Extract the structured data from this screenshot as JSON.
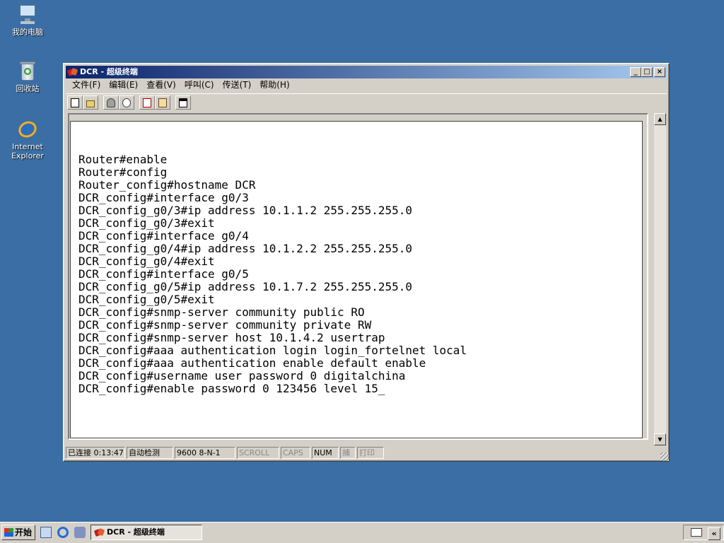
{
  "desktop": {
    "icons": [
      {
        "label": "我的电脑",
        "icon": "my-computer-icon"
      },
      {
        "label": "回收站",
        "icon": "recycle-bin-icon"
      },
      {
        "label": "Internet Explorer",
        "icon": "internet-explorer-icon"
      }
    ]
  },
  "window": {
    "title": "DCR - 超级终端",
    "controls": {
      "minimize": "_",
      "maximize": "□",
      "close": "×"
    },
    "menu": [
      {
        "label": "文件(F)"
      },
      {
        "label": "编辑(E)"
      },
      {
        "label": "查看(V)"
      },
      {
        "label": "呼叫(C)"
      },
      {
        "label": "传送(T)"
      },
      {
        "label": "帮助(H)"
      }
    ],
    "toolbar": [
      "new-file-icon",
      "open-folder-icon",
      "dial-phone-icon",
      "disconnect-icon",
      "send-file-icon",
      "receive-file-icon",
      "properties-icon"
    ],
    "terminal": {
      "lines": [
        "",
        "Router#enable",
        "Router#config",
        "Router_config#hostname DCR",
        "DCR_config#interface g0/3",
        "DCR_config_g0/3#ip address 10.1.1.2 255.255.255.0",
        "DCR_config_g0/3#exit",
        "DCR_config#interface g0/4",
        "DCR_config_g0/4#ip address 10.1.2.2 255.255.255.0",
        "DCR_config_g0/4#exit",
        "DCR_config#interface g0/5",
        "DCR_config_g0/5#ip address 10.1.7.2 255.255.255.0",
        "DCR_config_g0/5#exit",
        "DCR_config#snmp-server community public RO",
        "DCR_config#snmp-server community private RW",
        "DCR_config#snmp-server host 10.1.4.2 usertrap",
        "DCR_config#aaa authentication login login_fortelnet local",
        "DCR_config#aaa authentication enable default enable",
        "DCR_config#username user password 0 digitalchina",
        "DCR_config#enable password 0 123456 level 15_"
      ]
    },
    "statusbar": {
      "connected": "已连接 0:13:47",
      "detect": "自动检测",
      "params": "9600 8-N-1",
      "scroll": "SCROLL",
      "caps": "CAPS",
      "num": "NUM",
      "capture": "捕",
      "print": "打印"
    }
  },
  "taskbar": {
    "start": "开始",
    "task": "DCR - 超级终端"
  }
}
